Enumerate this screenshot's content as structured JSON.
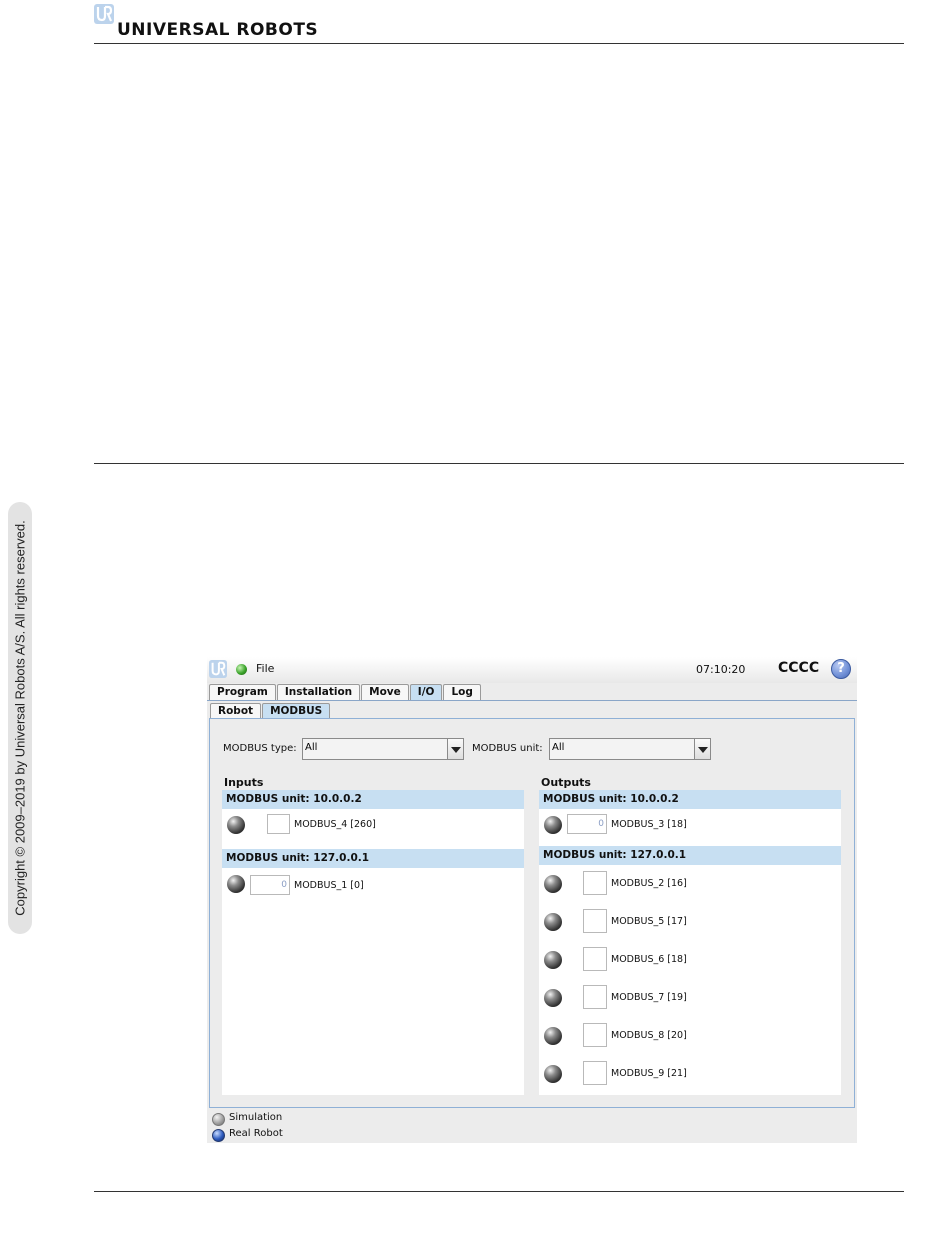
{
  "page": {
    "brand_name": "UNIVERSAL ROBOTS",
    "copyright": "Copyright © 2009–2019 by Universal Robots A/S. All rights reserved."
  },
  "app": {
    "menu_file": "File",
    "clock": "07:10:20",
    "robot_name": "CCCC",
    "help_label": "?",
    "main_tabs": [
      {
        "label": "Program",
        "active": false
      },
      {
        "label": "Installation",
        "active": false
      },
      {
        "label": "Move",
        "active": false
      },
      {
        "label": "I/O",
        "active": true
      },
      {
        "label": "Log",
        "active": false
      }
    ],
    "sub_tabs": [
      {
        "label": "Robot",
        "active": false
      },
      {
        "label": "MODBUS",
        "active": true
      }
    ],
    "filters": {
      "type_label": "MODBUS type:",
      "type_value": "All",
      "unit_label": "MODBUS unit:",
      "unit_value": "All"
    },
    "inputs": {
      "title": "Inputs",
      "units": [
        {
          "header": "MODBUS unit: 10.0.0.2",
          "signals": [
            {
              "label": "MODBUS_4 [260]",
              "value": ""
            }
          ]
        },
        {
          "header": "MODBUS unit: 127.0.0.1",
          "signals": [
            {
              "label": "MODBUS_1 [0]",
              "value": "0"
            }
          ]
        }
      ]
    },
    "outputs": {
      "title": "Outputs",
      "units": [
        {
          "header": "MODBUS unit: 10.0.0.2",
          "signals": [
            {
              "label": "MODBUS_3 [18]",
              "value": "0"
            }
          ]
        },
        {
          "header": "MODBUS unit: 127.0.0.1",
          "signals": [
            {
              "label": "MODBUS_2 [16]",
              "value": ""
            },
            {
              "label": "MODBUS_5 [17]",
              "value": ""
            },
            {
              "label": "MODBUS_6 [18]",
              "value": ""
            },
            {
              "label": "MODBUS_7 [19]",
              "value": ""
            },
            {
              "label": "MODBUS_8 [20]",
              "value": ""
            },
            {
              "label": "MODBUS_9 [21]",
              "value": ""
            }
          ]
        }
      ]
    },
    "modes": {
      "simulation": "Simulation",
      "real_robot": "Real Robot"
    }
  }
}
